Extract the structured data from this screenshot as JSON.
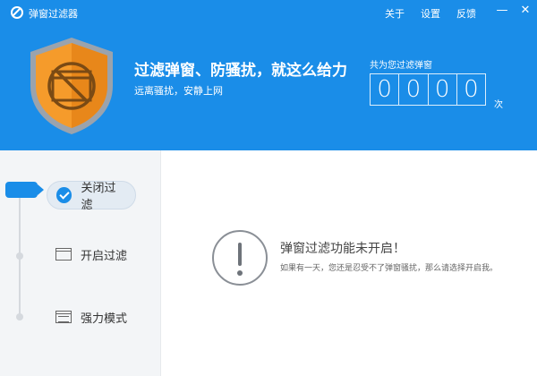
{
  "app": {
    "title": "弹窗过滤器"
  },
  "top_links": [
    "关于",
    "设置",
    "反馈"
  ],
  "window_controls": {
    "minimize": "—",
    "close": "✕"
  },
  "hero": {
    "headline": "过滤弹窗、防骚扰，就这么给力",
    "subline": "远离骚扰，安静上网"
  },
  "counter": {
    "label": "共为您过滤弹窗",
    "digits": [
      "0",
      "0",
      "0",
      "0"
    ],
    "unit": "次"
  },
  "modes": [
    {
      "label": "关闭过滤",
      "icon": "check-circle-icon",
      "active": true
    },
    {
      "label": "开启过滤",
      "icon": "window-icon",
      "active": false
    },
    {
      "label": "强力模式",
      "icon": "strong-window-icon",
      "active": false
    }
  ],
  "status": {
    "title": "弹窗过滤功能未开启！",
    "description": "如果有一天，您还是忍受不了弹窗骚扰，那么请选择开启我。"
  },
  "colors": {
    "accent": "#1a8de8",
    "shield_orange": "#f59b2b",
    "sidebar_bg": "#f3f5f7"
  }
}
